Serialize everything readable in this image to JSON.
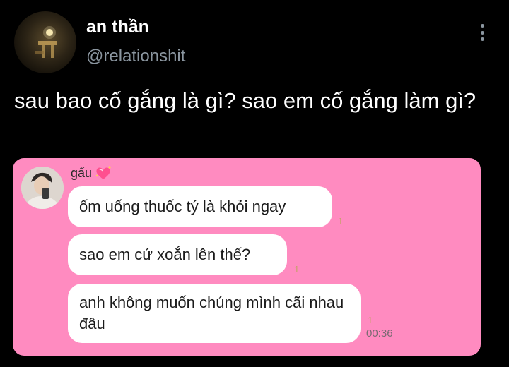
{
  "author": {
    "display_name": "an thần",
    "handle": "@relationshit"
  },
  "tweet": {
    "text": "sau bao cố gắng là gì? sao em cố gắng làm gì?"
  },
  "chat": {
    "sender": "gấu",
    "messages": [
      {
        "text": "ốm uống thuốc tý là khỏi ngay",
        "read_count": "1"
      },
      {
        "text": "sao em cứ xoắn lên thế?",
        "read_count": "1"
      },
      {
        "text": "anh không muốn chúng mình cãi nhau đâu",
        "read_count": "1",
        "time": "00:36"
      }
    ],
    "background_color": "#ff8bc0"
  },
  "icons": {
    "more": "more-vertical-icon",
    "sparkling_heart": "sparkling-heart-icon"
  },
  "colors": {
    "background": "#000000",
    "secondary_text": "#8b96a0"
  }
}
